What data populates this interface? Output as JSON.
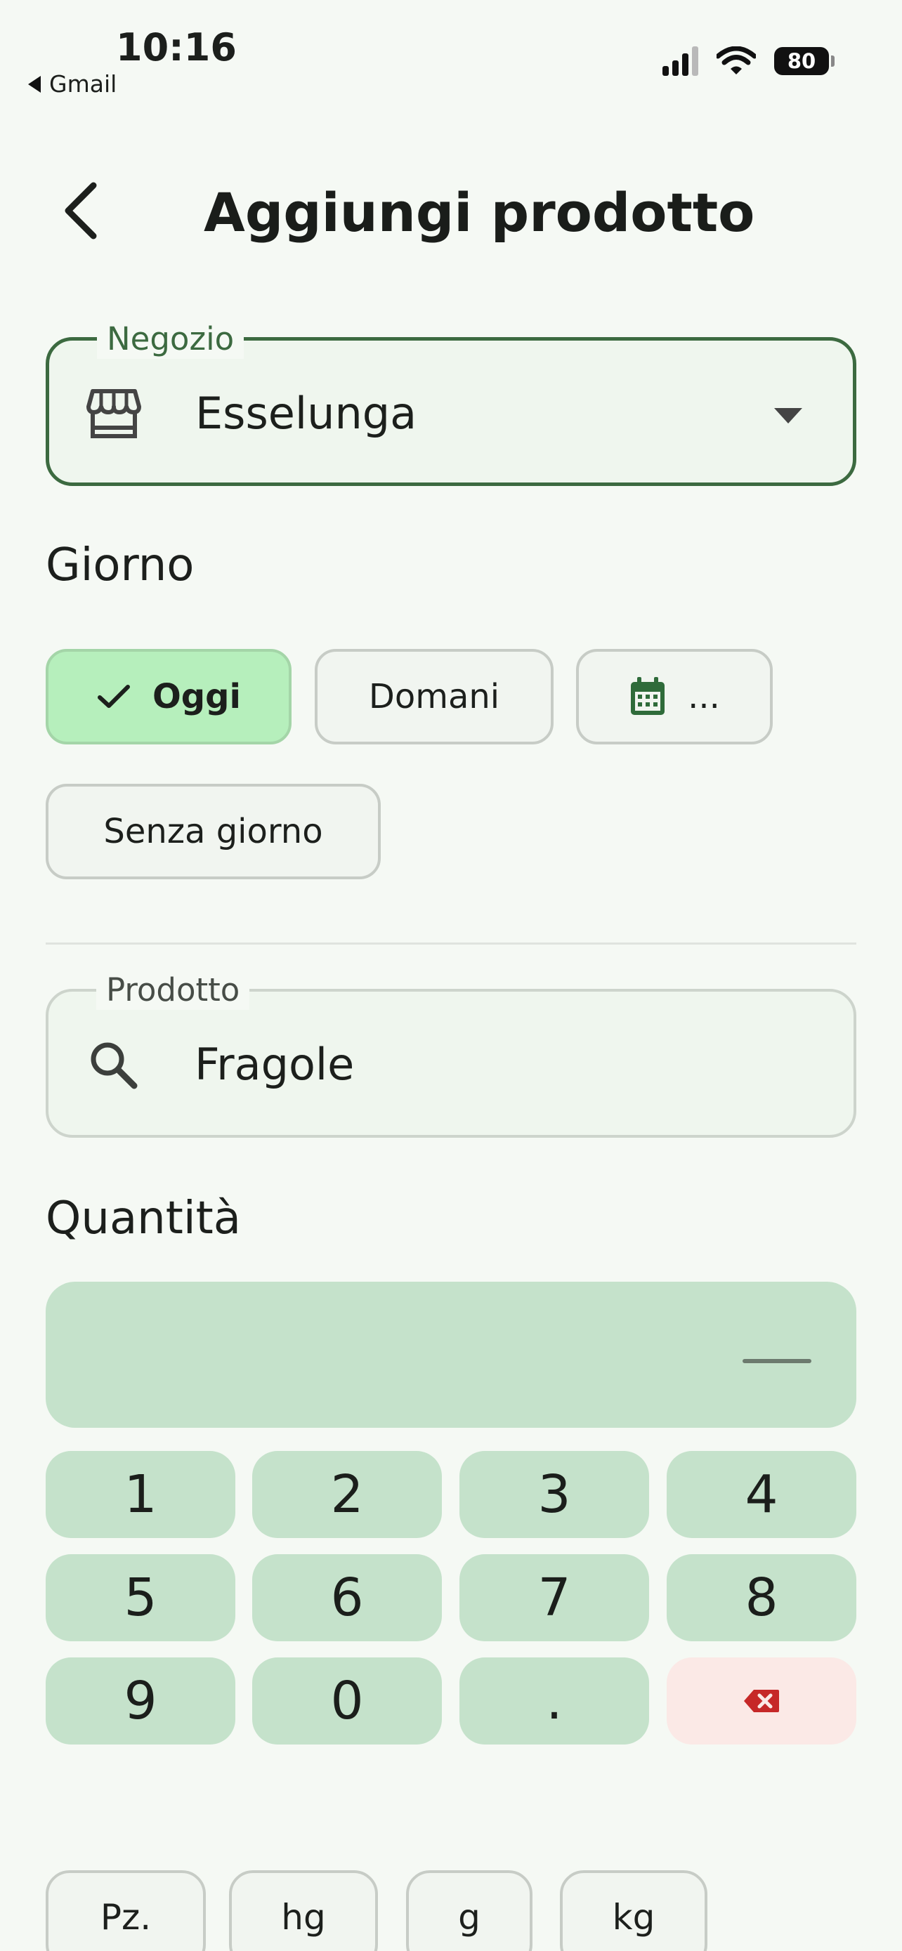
{
  "status_bar": {
    "time": "10:16",
    "back_app": "Gmail",
    "battery": "80"
  },
  "header": {
    "title": "Aggiungi prodotto"
  },
  "store_field": {
    "label": "Negozio",
    "value": "Esselunga"
  },
  "day_section": {
    "label": "Giorno",
    "chips": {
      "today": "Oggi",
      "tomorrow": "Domani",
      "custom": "...",
      "none": "Senza giorno"
    },
    "selected": "today"
  },
  "product_field": {
    "label": "Prodotto",
    "value": "Fragole"
  },
  "quantity": {
    "label": "Quantità",
    "keys": [
      "1",
      "2",
      "3",
      "4",
      "5",
      "6",
      "7",
      "8",
      "9",
      "0",
      "."
    ]
  },
  "units": [
    "Pz.",
    "hg",
    "g",
    "kg"
  ],
  "colors": {
    "accent": "#3c6a40",
    "selected_chip": "#b6efbc",
    "keypad": "#c5e2cb",
    "delete_key": "#fbe9e6",
    "delete_icon": "#c62828"
  }
}
